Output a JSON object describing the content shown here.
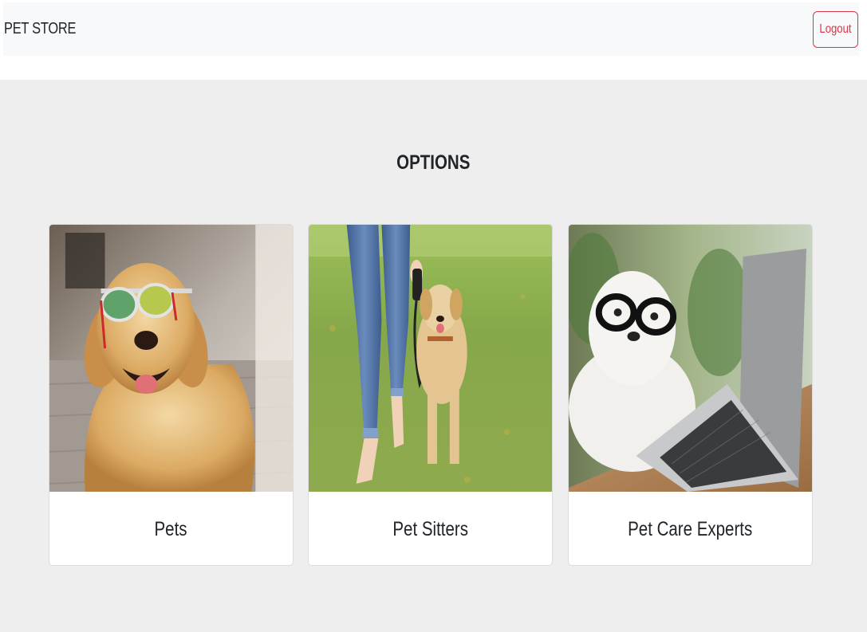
{
  "navbar": {
    "brand": "PET STORE",
    "logout_label": "Logout"
  },
  "main": {
    "title": "OPTIONS",
    "cards": [
      {
        "label": "Pets",
        "image": "golden-retriever-sunglasses"
      },
      {
        "label": "Pet Sitters",
        "image": "person-walking-dog"
      },
      {
        "label": "Pet Care Experts",
        "image": "dog-glasses-laptop"
      }
    ]
  },
  "colors": {
    "navbar_bg": "#f8f9fa",
    "section_bg": "#eeeeee",
    "logout": "#dc3545"
  }
}
